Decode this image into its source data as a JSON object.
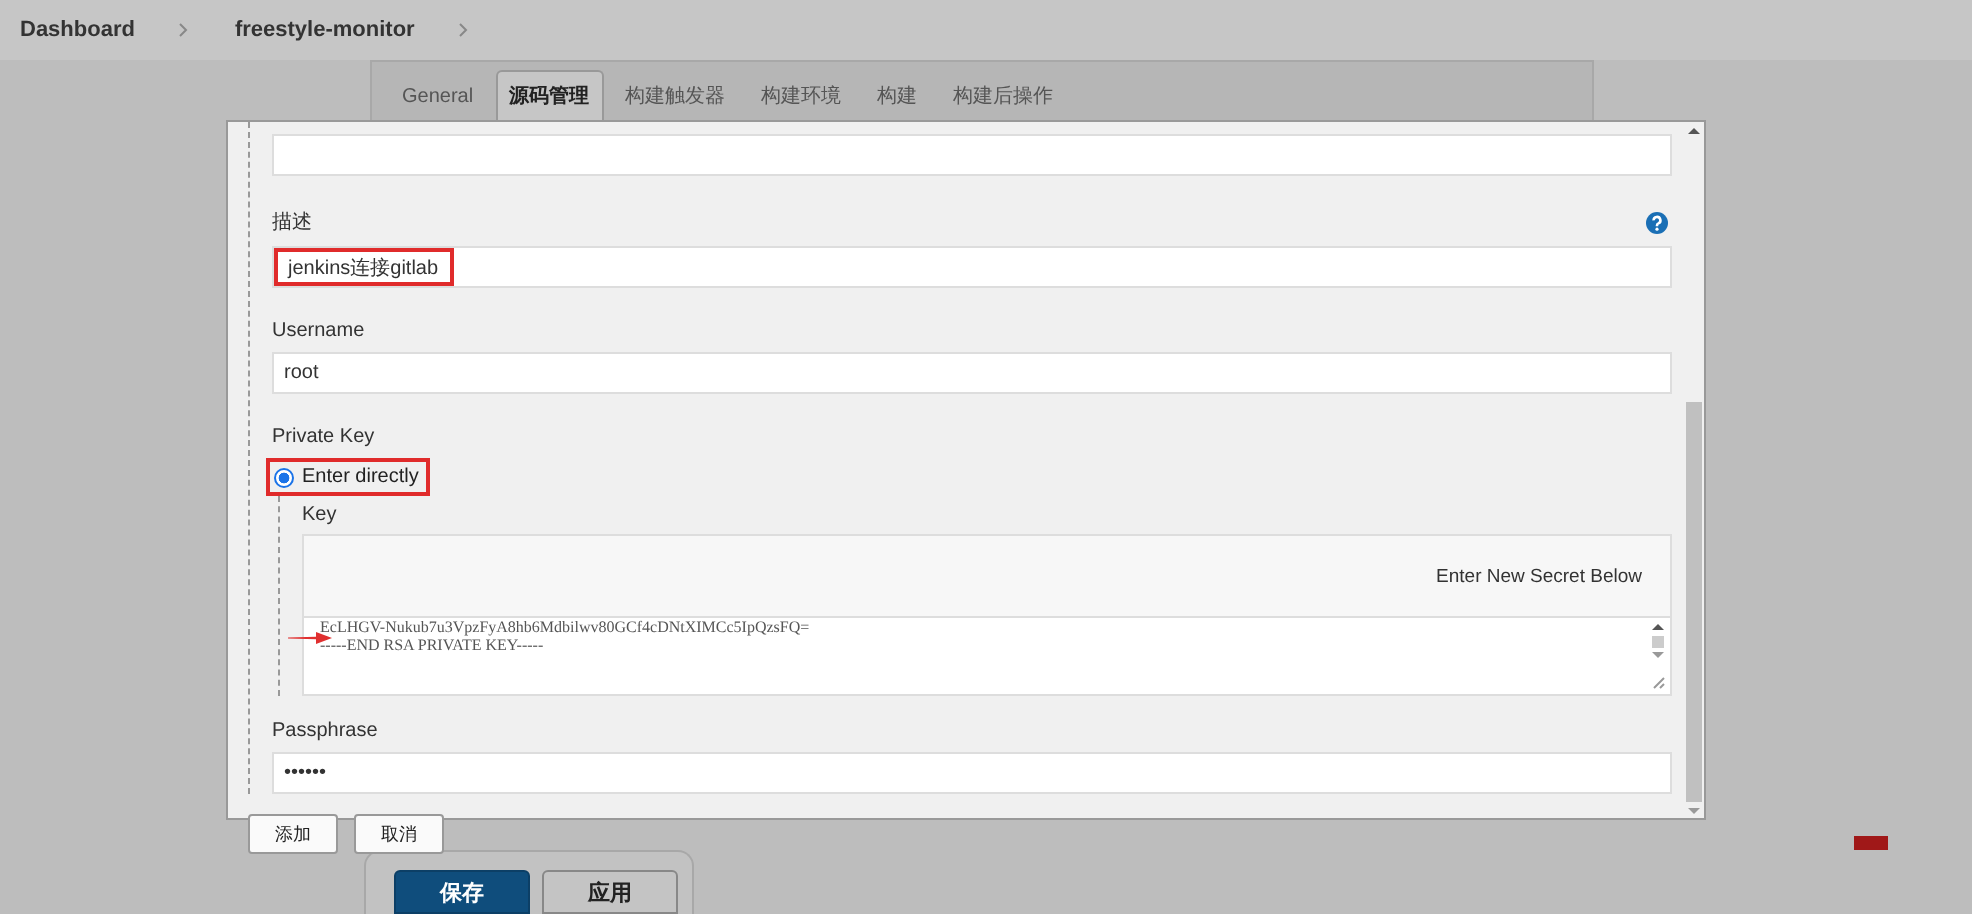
{
  "breadcrumbs": [
    {
      "label": "Dashboard"
    },
    {
      "label": "freestyle-monitor"
    }
  ],
  "tabs": [
    {
      "label": "General",
      "selected": false
    },
    {
      "label": "源码管理",
      "selected": true
    },
    {
      "label": "构建触发器",
      "selected": false
    },
    {
      "label": "构建环境",
      "selected": false
    },
    {
      "label": "构建",
      "selected": false
    },
    {
      "label": "构建后操作",
      "selected": false
    }
  ],
  "dialog": {
    "description": {
      "label": "描述",
      "value": "jenkins连接gitlab",
      "highlighted": true
    },
    "username": {
      "label": "Username",
      "value": "root"
    },
    "private_key": {
      "label": "Private Key",
      "options": [
        {
          "label": "Enter directly",
          "selected": true,
          "highlighted": true
        }
      ],
      "key": {
        "label": "Key",
        "hint": "Enter New Secret Below",
        "lines": [
          "EcLHGV-Nukub7u3VpzFyA8hb6Mdbilwv80GCf4cDNtXIMCc5IpQzsFQ=",
          "-----END RSA PRIVATE KEY-----"
        ]
      }
    },
    "passphrase": {
      "label": "Passphrase",
      "value": "••••••"
    },
    "buttons": [
      {
        "label": "添加"
      },
      {
        "label": "取消"
      }
    ]
  },
  "footer_buttons": [
    {
      "label": "保存",
      "kind": "primary"
    },
    {
      "label": "应用",
      "kind": "default"
    }
  ]
}
